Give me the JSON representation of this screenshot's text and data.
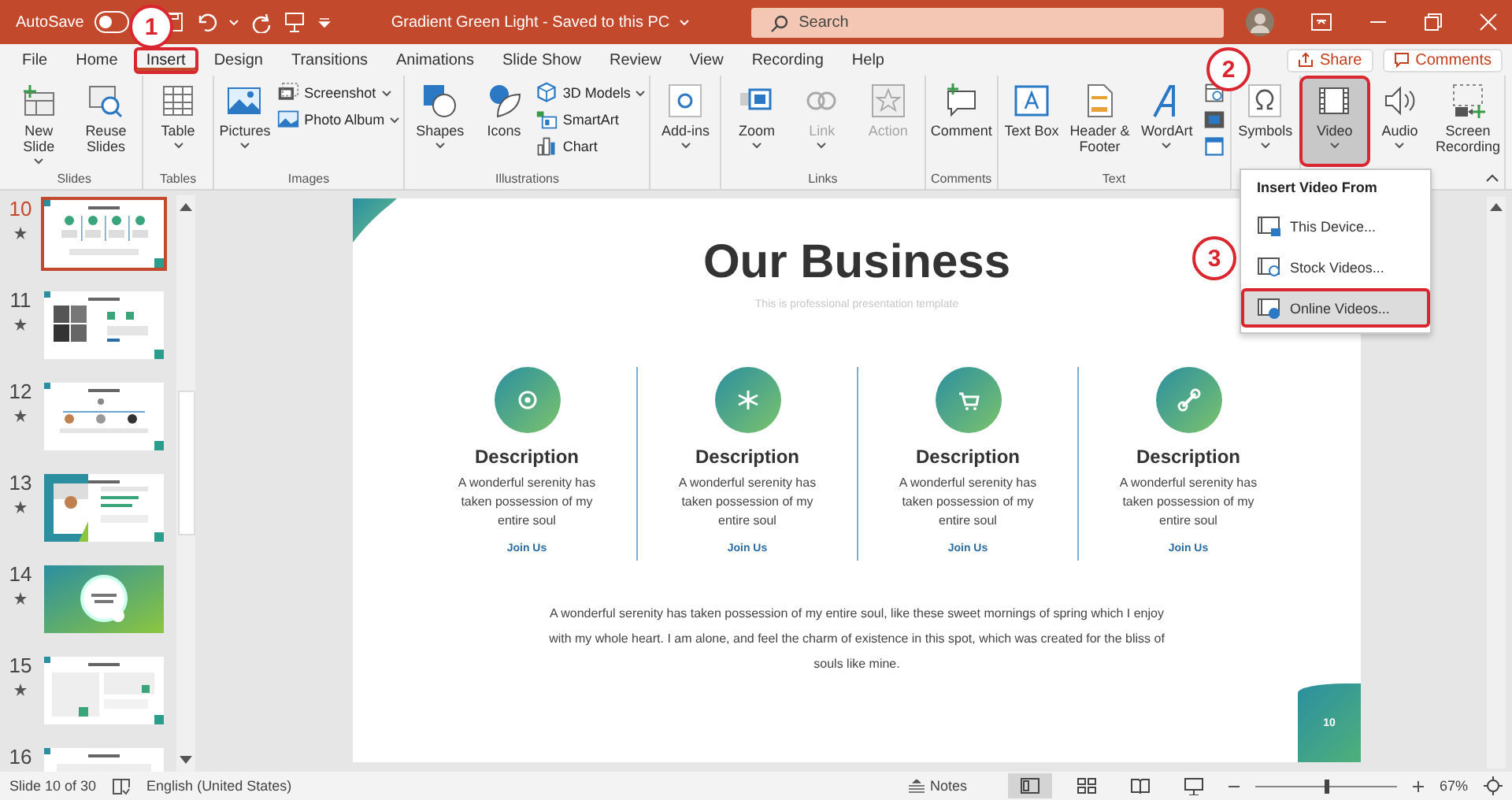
{
  "title_bar": {
    "autosave_label": "AutoSave",
    "autosave_on": false,
    "document_title": "Gradient Green Light  -  Saved to this PC",
    "search": {
      "placeholder": "Search"
    }
  },
  "menu_tabs": [
    {
      "label": "File",
      "selected": false,
      "highlighted": false
    },
    {
      "label": "Home",
      "selected": false,
      "highlighted": false
    },
    {
      "label": "Insert",
      "selected": true,
      "highlighted": true
    },
    {
      "label": "Design",
      "selected": false,
      "highlighted": false
    },
    {
      "label": "Transitions",
      "selected": false,
      "highlighted": false
    },
    {
      "label": "Animations",
      "selected": false,
      "highlighted": false
    },
    {
      "label": "Slide Show",
      "selected": false,
      "highlighted": false
    },
    {
      "label": "Review",
      "selected": false,
      "highlighted": false
    },
    {
      "label": "View",
      "selected": false,
      "highlighted": false
    },
    {
      "label": "Recording",
      "selected": false,
      "highlighted": false
    },
    {
      "label": "Help",
      "selected": false,
      "highlighted": false
    }
  ],
  "share_button": "Share",
  "comments_button": "Comments",
  "ribbon_groups": [
    {
      "label": "Slides",
      "items": [
        {
          "kind": "large",
          "label": "New Slide",
          "dropdown": true,
          "disabled": false,
          "selected": false,
          "highlighted": false
        },
        {
          "kind": "large",
          "label": "Reuse Slides",
          "dropdown": false,
          "disabled": false,
          "selected": false,
          "highlighted": false
        }
      ]
    },
    {
      "label": "Tables",
      "items": [
        {
          "kind": "large",
          "label": "Table",
          "dropdown": true,
          "disabled": false,
          "selected": false,
          "highlighted": false
        }
      ]
    },
    {
      "label": "Images",
      "items": [
        {
          "kind": "large",
          "label": "Pictures",
          "dropdown": true,
          "disabled": false,
          "selected": false,
          "highlighted": false
        },
        {
          "kind": "small",
          "label": "Screenshot",
          "dropdown": true,
          "disabled": false,
          "selected": false,
          "highlighted": false
        },
        {
          "kind": "small",
          "label": "Photo Album",
          "dropdown": true,
          "disabled": false,
          "selected": false,
          "highlighted": false
        }
      ]
    },
    {
      "label": "Illustrations",
      "items": [
        {
          "kind": "large",
          "label": "Shapes",
          "dropdown": true,
          "disabled": false,
          "selected": false,
          "highlighted": false
        },
        {
          "kind": "large",
          "label": "Icons",
          "dropdown": false,
          "disabled": false,
          "selected": false,
          "highlighted": false
        },
        {
          "kind": "small",
          "label": "3D Models",
          "dropdown": true,
          "disabled": false,
          "selected": false,
          "highlighted": false
        },
        {
          "kind": "small",
          "label": "SmartArt",
          "dropdown": false,
          "disabled": false,
          "selected": false,
          "highlighted": false
        },
        {
          "kind": "small",
          "label": "Chart",
          "dropdown": false,
          "disabled": false,
          "selected": false,
          "highlighted": false
        }
      ]
    },
    {
      "items": [
        {
          "kind": "large",
          "label": "Add-ins",
          "dropdown": true,
          "disabled": false,
          "selected": false,
          "highlighted": false
        }
      ]
    },
    {
      "label": "Links",
      "items": [
        {
          "kind": "large",
          "label": "Zoom",
          "dropdown": true,
          "disabled": false,
          "selected": false,
          "highlighted": false
        },
        {
          "kind": "large",
          "label": "Link",
          "dropdown": true,
          "disabled": true,
          "selected": false,
          "highlighted": false
        },
        {
          "kind": "large",
          "label": "Action",
          "dropdown": false,
          "disabled": true,
          "selected": false,
          "highlighted": false
        }
      ]
    },
    {
      "label": "Comments",
      "items": [
        {
          "kind": "large",
          "label": "Comment",
          "dropdown": false,
          "disabled": false,
          "selected": false,
          "highlighted": false
        }
      ]
    },
    {
      "label": "Text",
      "items": [
        {
          "kind": "large",
          "label": "Text Box",
          "dropdown": false,
          "disabled": false,
          "selected": false,
          "highlighted": false
        },
        {
          "kind": "large",
          "label": "Header & Footer",
          "dropdown": false,
          "disabled": false,
          "selected": false,
          "highlighted": false
        },
        {
          "kind": "large",
          "label": "WordArt",
          "dropdown": true,
          "disabled": false,
          "selected": false,
          "highlighted": false
        },
        {
          "kind": "icon",
          "disabled": false,
          "selected": false,
          "highlighted": false
        },
        {
          "kind": "icon",
          "disabled": false,
          "selected": false,
          "highlighted": false
        },
        {
          "kind": "icon",
          "disabled": false,
          "selected": false,
          "highlighted": false
        }
      ]
    },
    {
      "items": [
        {
          "kind": "large",
          "label": "Symbols",
          "dropdown": true,
          "disabled": false,
          "selected": false,
          "highlighted": false
        }
      ]
    },
    {
      "items": [
        {
          "kind": "large",
          "label": "Video",
          "dropdown": true,
          "disabled": false,
          "selected": true,
          "highlighted": true
        },
        {
          "kind": "large",
          "label": "Audio",
          "dropdown": true,
          "disabled": false,
          "selected": false,
          "highlighted": false
        },
        {
          "kind": "large",
          "label": "Screen Recording",
          "dropdown": false,
          "disabled": false,
          "selected": false,
          "highlighted": false
        }
      ]
    }
  ],
  "video_menu": {
    "title": "Insert Video From",
    "items": [
      {
        "label": "This Device...",
        "selected": false,
        "highlighted": false
      },
      {
        "label": "Stock Videos...",
        "selected": false,
        "highlighted": false
      },
      {
        "label": "Online Videos...",
        "selected": true,
        "highlighted": true
      }
    ]
  },
  "callouts": [
    {
      "number": "1"
    },
    {
      "number": "2"
    },
    {
      "number": "3"
    }
  ],
  "thumbnails": [
    {
      "number": "10",
      "selected": true
    },
    {
      "number": "11",
      "selected": false
    },
    {
      "number": "12",
      "selected": false
    },
    {
      "number": "13",
      "selected": false
    },
    {
      "number": "14",
      "selected": false
    },
    {
      "number": "15",
      "selected": false
    },
    {
      "number": "16",
      "selected": false
    }
  ],
  "slide": {
    "title": "Our Business",
    "subtitle": "This is professional presentation template",
    "columns": [
      {
        "heading": "Description",
        "text": "A wonderful serenity has taken possession of my entire soul",
        "link": "Join Us"
      },
      {
        "heading": "Description",
        "text": "A wonderful serenity has taken possession of my entire soul",
        "link": "Join Us"
      },
      {
        "heading": "Description",
        "text": "A wonderful serenity has taken possession of my entire soul",
        "link": "Join Us"
      },
      {
        "heading": "Description",
        "text": "A wonderful serenity has taken possession of my entire soul",
        "link": "Join Us"
      }
    ],
    "paragraph": "A wonderful serenity has taken possession of my entire soul, like these sweet mornings of spring which I enjoy with my whole heart. I am alone, and feel the charm of existence in this spot, which was created for the bliss of souls like mine.",
    "page_number": "10"
  },
  "status_bar": {
    "slide_position": "Slide 10 of 30",
    "language": "English (United States)",
    "notes": "Notes",
    "zoom": {
      "level": 0.5
    },
    "zoom_percent": "67%"
  }
}
